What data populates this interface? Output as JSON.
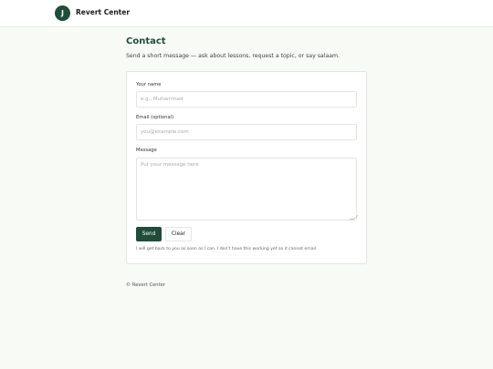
{
  "header": {
    "logo_letter": "J",
    "brand": "Revert Center"
  },
  "contact": {
    "title": "Contact",
    "subtitle": "Send a short message — ask about lessons, request a topic, or say salaam."
  },
  "form": {
    "name_label": "Your name",
    "name_value": "",
    "name_placeholder": "e.g., Muhammad",
    "email_label": "Email (optional)",
    "email_value": "",
    "email_placeholder": "you@example.com",
    "message_label": "Message",
    "message_value": "",
    "message_placeholder": "Put your message here",
    "send_label": "Send",
    "clear_label": "Clear",
    "note": "I will get back to you as soon as I can. I don't have this working yet so it cannot email"
  },
  "footer": {
    "text": "© Revert Center"
  },
  "colors": {
    "accent": "#1f4d3a",
    "page_background": "#f8faf6"
  }
}
